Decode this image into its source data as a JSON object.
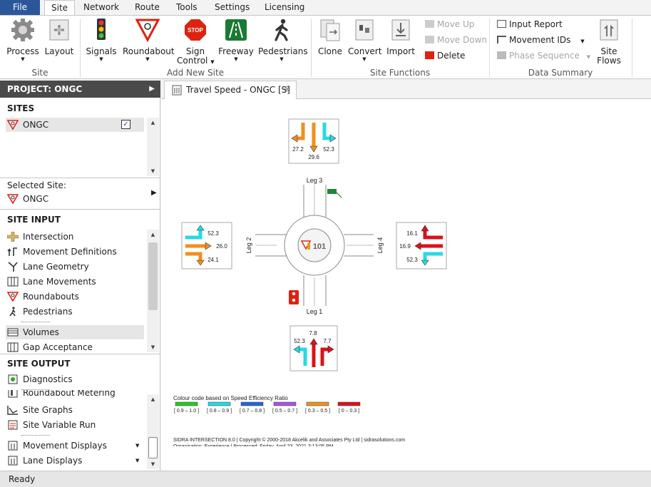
{
  "menu": {
    "file": "File",
    "tabs": [
      "Site",
      "Network",
      "Route",
      "Tools",
      "Settings",
      "Licensing"
    ],
    "active_tab": "Site"
  },
  "ribbon": {
    "site_group": {
      "process": "Process",
      "layout": "Layout",
      "label": "Site"
    },
    "add_group": {
      "signals": "Signals",
      "roundabout": "Roundabout",
      "sign_control_1": "Sign",
      "sign_control_2": "Control",
      "stop_sign_text": "STOP",
      "freeway": "Freeway",
      "pedestrians": "Pedestrians",
      "label": "Add New Site"
    },
    "functions_group": {
      "clone": "Clone",
      "convert": "Convert",
      "import": "Import",
      "move_up": "Move Up",
      "move_down": "Move Down",
      "delete": "Delete",
      "label": "Site Functions"
    },
    "summary_group": {
      "input_report": "Input Report",
      "movement_ids": "Movement IDs",
      "phase_sequence": "Phase Sequence",
      "site_flows_1": "Site",
      "site_flows_2": "Flows",
      "label": "Data Summary"
    }
  },
  "left_panel": {
    "project_label": "PROJECT:",
    "project_name": "ONGC",
    "sites_heading": "SITES",
    "sites": [
      {
        "name": "ONGC",
        "checked": true
      }
    ],
    "selected_site_label": "Selected Site:",
    "selected_site_name": "ONGC",
    "site_input_heading": "SITE INPUT",
    "site_input_items": [
      "Intersection",
      "Movement Definitions",
      "Lane Geometry",
      "Lane Movements",
      "Roundabouts",
      "Pedestrians",
      "Volumes",
      "Gap Acceptance"
    ],
    "site_input_selected": "Volumes",
    "site_output_heading": "SITE OUTPUT",
    "site_output_items": [
      "Diagnostics",
      "Roundabout Metering",
      "Site Graphs",
      "Site Variable Run",
      "Movement Displays",
      "Lane Displays"
    ]
  },
  "document": {
    "tab_title": "Travel Speed - ONGC [S]",
    "diagram": {
      "site_id": "101",
      "legs": {
        "top": "Leg 3",
        "bottom": "Leg 1",
        "left": "Leg 2",
        "right": "Leg 4"
      },
      "north_approach": {
        "left": "27.2",
        "through": "29.6",
        "right": "52.3"
      },
      "west_approach": {
        "top": "52.3",
        "middle": "26.0",
        "bottom": "24.1"
      },
      "east_approach": {
        "top": "16.1",
        "middle": "16.9",
        "bottom": "52.3"
      },
      "south_approach": {
        "left": "52.3",
        "through": "7.8",
        "right": "7.7"
      }
    },
    "legend": {
      "title": "Colour code based on Speed Efficiency Ratio",
      "items": [
        {
          "label": "[ 0.9 – 1.0 ]",
          "color": "#22cc22"
        },
        {
          "label": "[ 0.8 – 0.9 ]",
          "color": "#27d9e6"
        },
        {
          "label": "[ 0.7 – 0.8 ]",
          "color": "#2266dd"
        },
        {
          "label": "[ 0.5 – 0.7 ]",
          "color": "#a855e0"
        },
        {
          "label": "[ 0.3 – 0.5 ]",
          "color": "#f0901e"
        },
        {
          "label": "[ 0 – 0.3 ]",
          "color": "#d8131b"
        }
      ]
    },
    "footer_line1": "SIDRA INTERSECTION 8.0  |  Copyright © 2000-2018 Akcelik and Associates Pty Ltd  |  sidrasolutions.com",
    "footer_line2": "Organisation: Experience  |  Processed: Friday, April 23, 2021 3:13:05 PM"
  },
  "colors": {
    "cyan": "#27d9e6",
    "orange": "#f0901e",
    "red": "#d8131b",
    "accent": "#2b579a"
  },
  "status": "Ready"
}
